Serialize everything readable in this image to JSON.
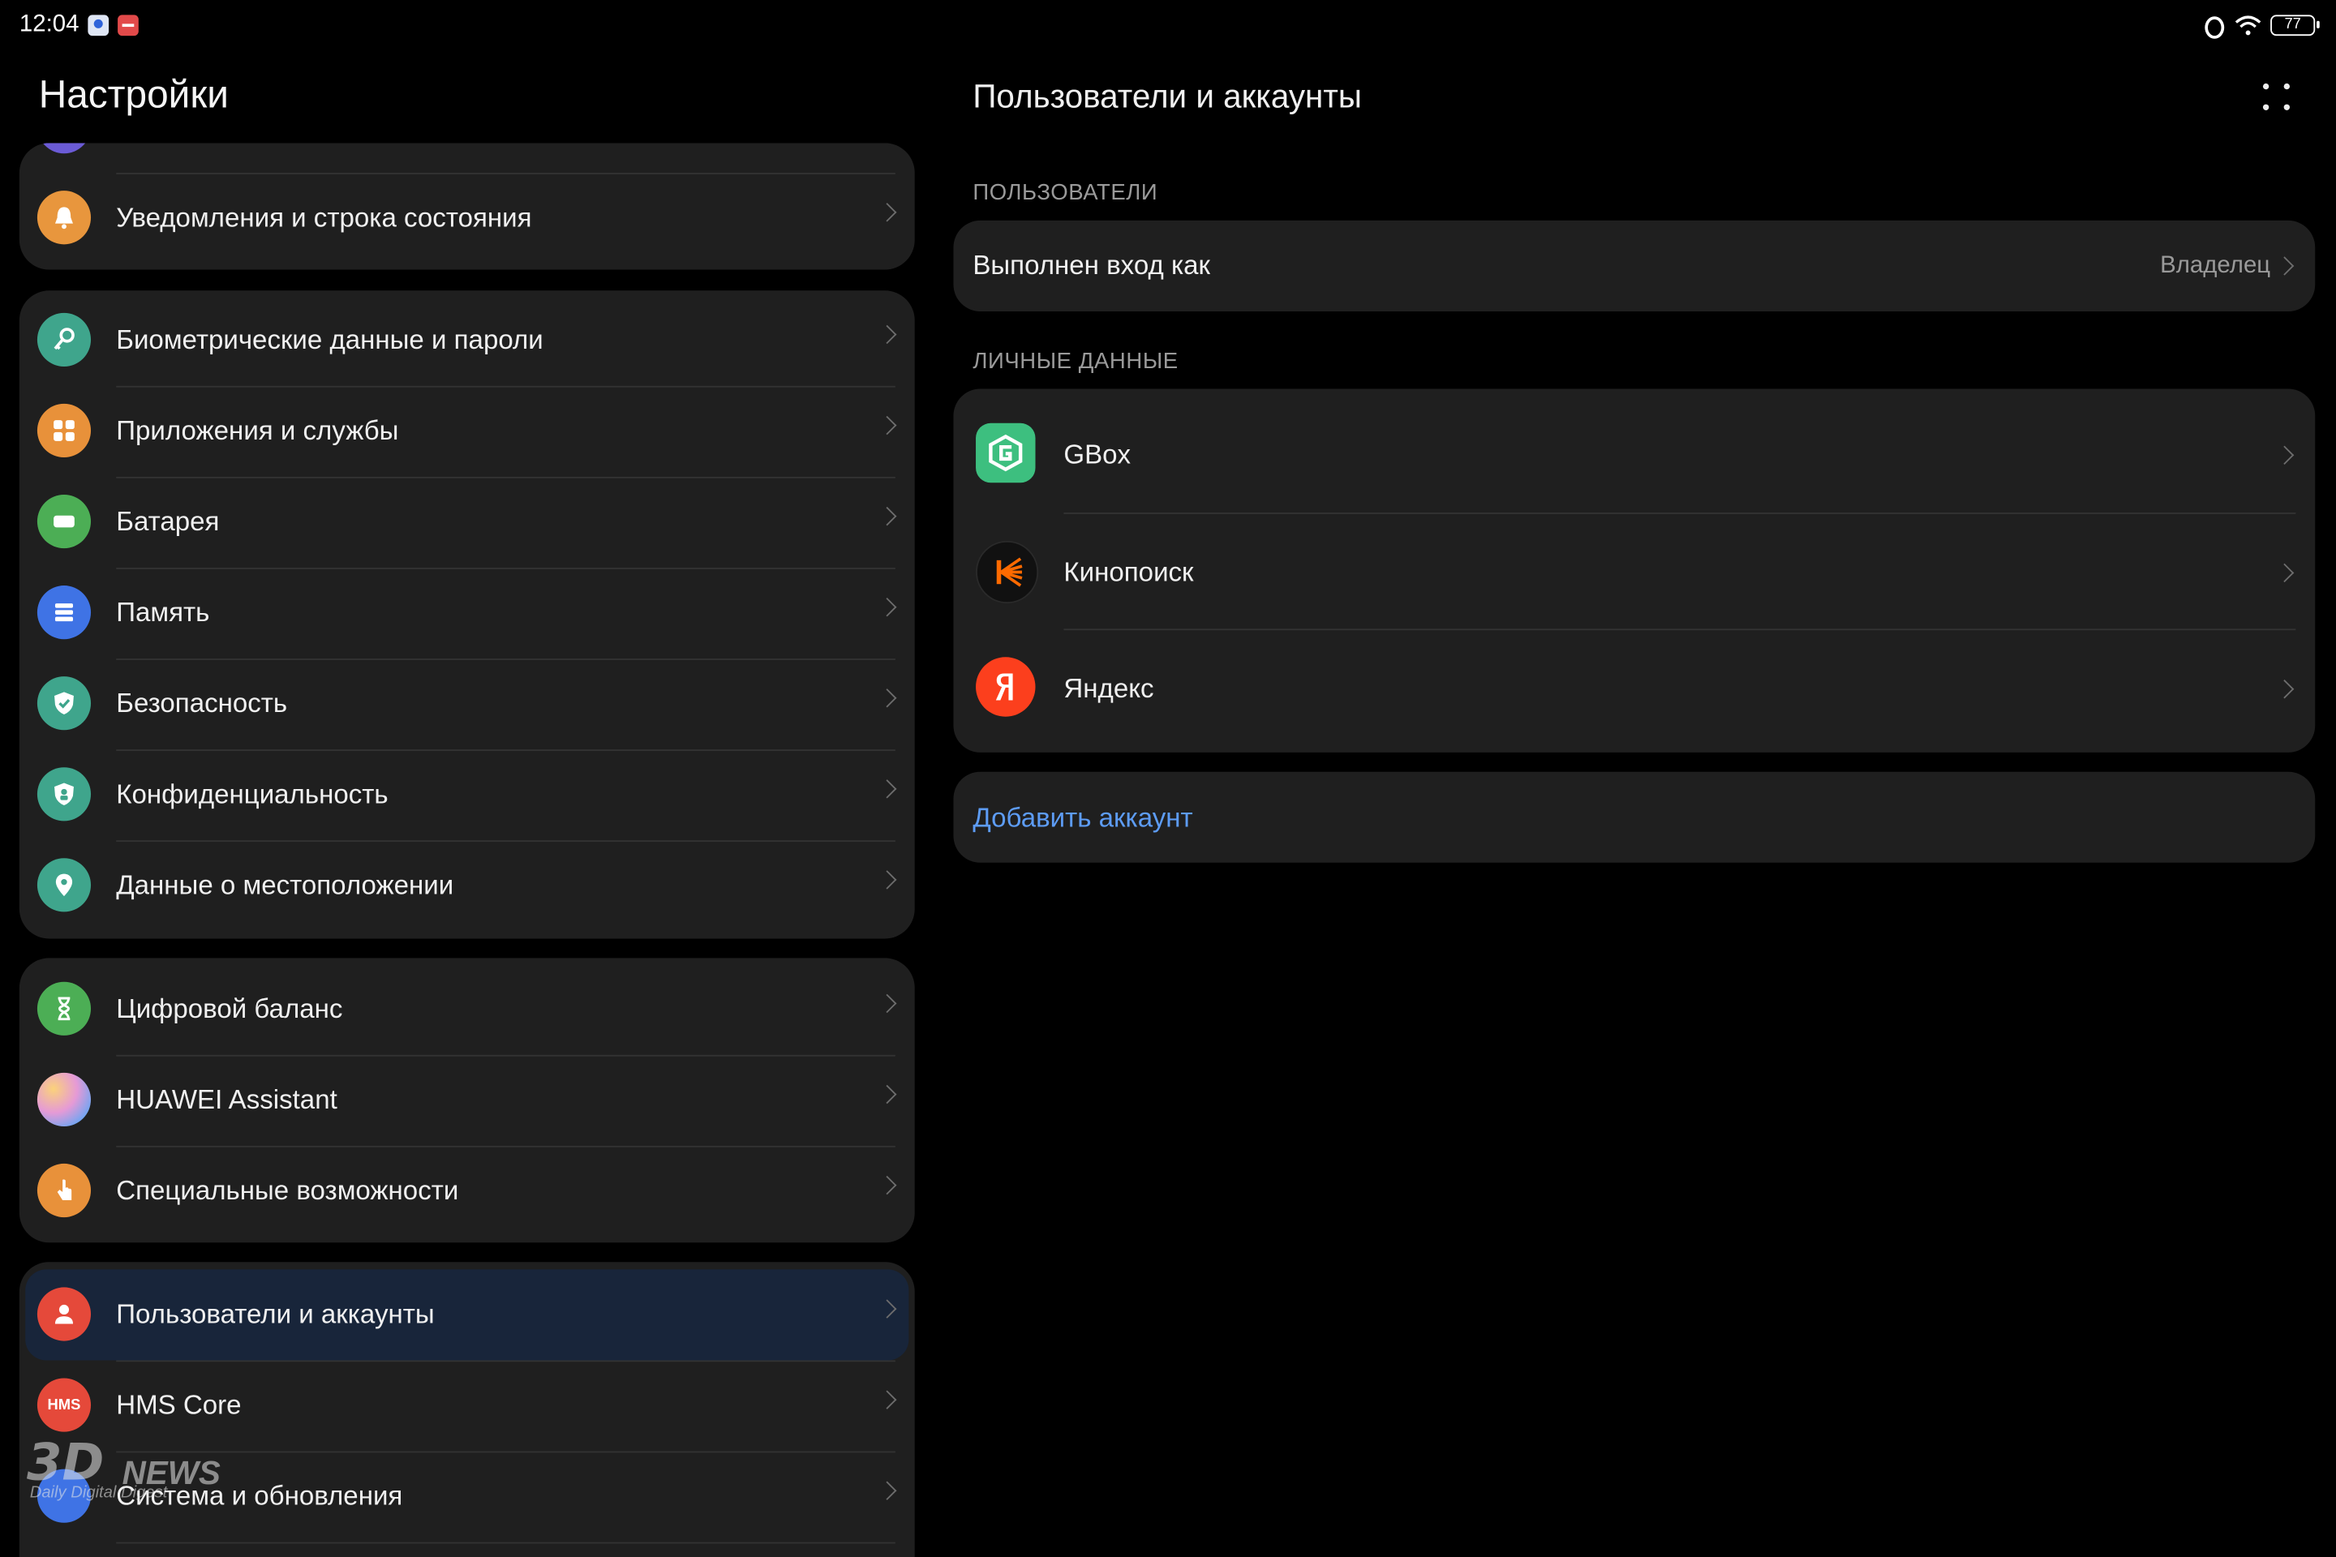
{
  "status_bar": {
    "time": "12:04",
    "battery": "77",
    "icons": [
      "nfc-icon",
      "wifi-icon",
      "battery-icon"
    ]
  },
  "left": {
    "title": "Настройки",
    "groups": [
      {
        "items": [
          {
            "label": "",
            "icon": "display-icon",
            "color": "#6b5bd6"
          },
          {
            "label": "Уведомления и строка состояния",
            "icon": "bell-icon",
            "color": "#e8963d"
          }
        ]
      },
      {
        "items": [
          {
            "label": "Биометрические данные и пароли",
            "icon": "key-icon",
            "color": "#3fa58c"
          },
          {
            "label": "Приложения и службы",
            "icon": "apps-icon",
            "color": "#e8913a"
          },
          {
            "label": "Батарея",
            "icon": "battery-icon",
            "color": "#4cae55"
          },
          {
            "label": "Память",
            "icon": "storage-icon",
            "color": "#3f73e5"
          },
          {
            "label": "Безопасность",
            "icon": "shield-check-icon",
            "color": "#3fa58c"
          },
          {
            "label": "Конфиденциальность",
            "icon": "privacy-icon",
            "color": "#3fa58c"
          },
          {
            "label": "Данные о местоположении",
            "icon": "location-icon",
            "color": "#3fa58c"
          }
        ]
      },
      {
        "items": [
          {
            "label": "Цифровой баланс",
            "icon": "hourglass-icon",
            "color": "#4cae55"
          },
          {
            "label": "HUAWEI Assistant",
            "icon": "assistant-icon",
            "color": "#c98bdf"
          },
          {
            "label": "Специальные возможности",
            "icon": "accessibility-hand-icon",
            "color": "#e8913a"
          }
        ]
      },
      {
        "items": [
          {
            "label": "Пользователи и аккаунты",
            "icon": "user-icon",
            "color": "#e5493a",
            "selected": true
          },
          {
            "label": "HMS Core",
            "icon": "hms-icon",
            "color": "#e5493a",
            "badge": "HMS"
          },
          {
            "label": "Система и обновления",
            "icon": "system-icon",
            "color": "#3f73e5"
          }
        ]
      }
    ]
  },
  "right": {
    "title": "Пользователи и аккаунты",
    "users_header": "ПОЛЬЗОВАТЕЛИ",
    "logged_in_label": "Выполнен вход как",
    "logged_in_value": "Владелец",
    "personal_header": "ЛИЧНЫЕ ДАННЫЕ",
    "accounts": [
      {
        "label": "GBox",
        "icon": "gbox-icon",
        "color": "#3dbf7f"
      },
      {
        "label": "Кинопоиск",
        "icon": "kinopoisk-icon",
        "color": "#ff6a00"
      },
      {
        "label": "Яндекс",
        "icon": "yandex-icon",
        "color": "#fc3f1d"
      }
    ],
    "add_account": "Добавить аккаунт"
  },
  "watermark": {
    "brand": "3D",
    "news": "NEWS",
    "tagline": "Daily Digital Digest"
  }
}
